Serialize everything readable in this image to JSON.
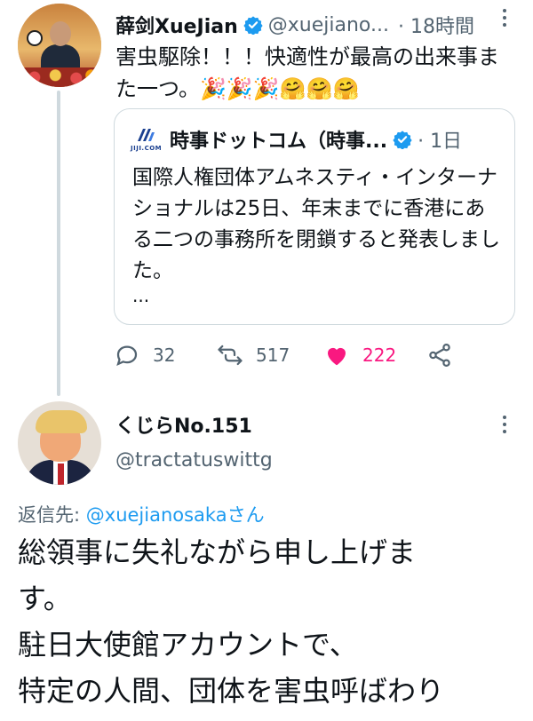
{
  "tweet": {
    "author_name": "薛剑XueJian",
    "author_handle": "@xuejiano...",
    "time": "· 18時間",
    "text": "害虫駆除！！！快適性が最高の出来事また一つ。🎉🎉🎉🤗🤗🤗",
    "quote": {
      "logo_text": "JIJI.COM",
      "source_name": "時事ドットコム（時事...",
      "time": "· 1日",
      "text": "国際人権団体アムネスティ・インターナショナルは25日、年末までに香港にある二つの事務所を閉鎖すると発表しました。",
      "ellipsis": "..."
    },
    "actions": {
      "replies": "32",
      "retweets": "517",
      "likes": "222"
    }
  },
  "reply": {
    "author_name": "くじらNo.151",
    "author_handle": "@tractatuswittg",
    "reply_prefix": "返信先: ",
    "reply_mention": "@xuejianosakaさん",
    "lines": [
      "総領事に失礼ながら申し上げま",
      "す。",
      "駐日大使館アカウントで、",
      "特定の人間、団体を害虫呼ばわり"
    ]
  },
  "colors": {
    "accent": "#1d9bf0",
    "like": "#f91880",
    "secondary_text": "#536471",
    "border": "#cfd9de"
  }
}
